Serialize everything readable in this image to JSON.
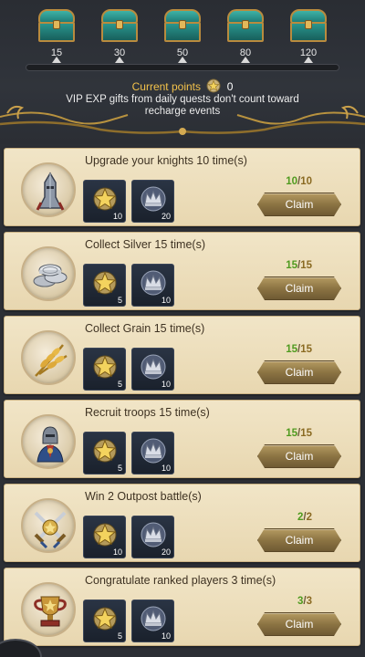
{
  "header": {
    "milestones": [
      "15",
      "30",
      "50",
      "80",
      "120"
    ],
    "current_label": "Current points",
    "current_value": "0",
    "notice": "VIP EXP gifts from daily quests don't count toward recharge events"
  },
  "tasks": [
    {
      "title": "Upgrade your knights 10 time(s)",
      "icon": "knight-helmet-icon",
      "rewards": [
        {
          "icon": "vip-star-icon",
          "qty": "10"
        },
        {
          "icon": "silver-crown-icon",
          "qty": "20"
        }
      ],
      "done": "10",
      "total": "10",
      "button": "Claim"
    },
    {
      "title": "Collect Silver 15 time(s)",
      "icon": "silver-coins-icon",
      "rewards": [
        {
          "icon": "vip-star-icon",
          "qty": "5"
        },
        {
          "icon": "silver-crown-icon",
          "qty": "10"
        }
      ],
      "done": "15",
      "total": "15",
      "button": "Claim"
    },
    {
      "title": "Collect Grain 15 time(s)",
      "icon": "grain-icon",
      "rewards": [
        {
          "icon": "vip-star-icon",
          "qty": "5"
        },
        {
          "icon": "silver-crown-icon",
          "qty": "10"
        }
      ],
      "done": "15",
      "total": "15",
      "button": "Claim"
    },
    {
      "title": "Recruit troops 15 time(s)",
      "icon": "soldier-icon",
      "rewards": [
        {
          "icon": "vip-star-icon",
          "qty": "5"
        },
        {
          "icon": "silver-crown-icon",
          "qty": "10"
        }
      ],
      "done": "15",
      "total": "15",
      "button": "Claim"
    },
    {
      "title": "Win 2 Outpost battle(s)",
      "icon": "crossed-swords-icon",
      "rewards": [
        {
          "icon": "vip-star-icon",
          "qty": "10"
        },
        {
          "icon": "silver-crown-icon",
          "qty": "20"
        }
      ],
      "done": "2",
      "total": "2",
      "button": "Claim"
    },
    {
      "title": "Congratulate ranked players 3 time(s)",
      "icon": "trophy-icon",
      "rewards": [
        {
          "icon": "vip-star-icon",
          "qty": "5"
        },
        {
          "icon": "silver-crown-icon",
          "qty": "10"
        }
      ],
      "done": "3",
      "total": "3",
      "button": "Claim"
    }
  ],
  "colors": {
    "accent_gold": "#f3c24a",
    "progress_done": "#4f9a1f",
    "panel": "#f1e5c7",
    "background": "#2c2f35"
  }
}
